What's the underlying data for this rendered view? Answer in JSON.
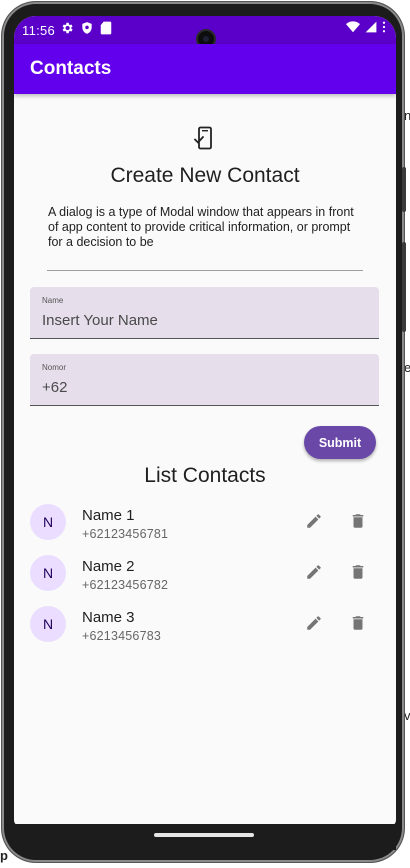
{
  "status_bar": {
    "time": "11:56",
    "left_icons": [
      "gear-icon",
      "shield-icon",
      "sd-card-icon"
    ],
    "right_icons": [
      "wifi-icon",
      "signal-icon",
      "more-vert-icon"
    ]
  },
  "app_bar": {
    "title": "Contacts"
  },
  "dialog": {
    "icon": "mobile-check-icon",
    "title": "Create New Contact",
    "description": "A dialog is a type of Modal window that appears in front of app content to provide critical information, or prompt for a decision to be"
  },
  "form": {
    "name_field": {
      "label": "Name",
      "placeholder": "Insert Your Name",
      "value": ""
    },
    "phone_field": {
      "label": "Nomor",
      "placeholder": "+62",
      "value": ""
    },
    "submit_label": "Submit"
  },
  "list": {
    "title": "List Contacts",
    "contacts": [
      {
        "initial": "N",
        "name": "Name 1",
        "phone": "+62123456781"
      },
      {
        "initial": "N",
        "name": "Name 2",
        "phone": "+62123456782"
      },
      {
        "initial": "N",
        "name": "Name 3",
        "phone": "+6213456783"
      }
    ]
  },
  "colors": {
    "primary": "#6200ee",
    "status_bar": "#5a00c8",
    "button": "#6948a8",
    "field_fill": "#e7deec",
    "avatar_fill": "#eaddff"
  }
}
